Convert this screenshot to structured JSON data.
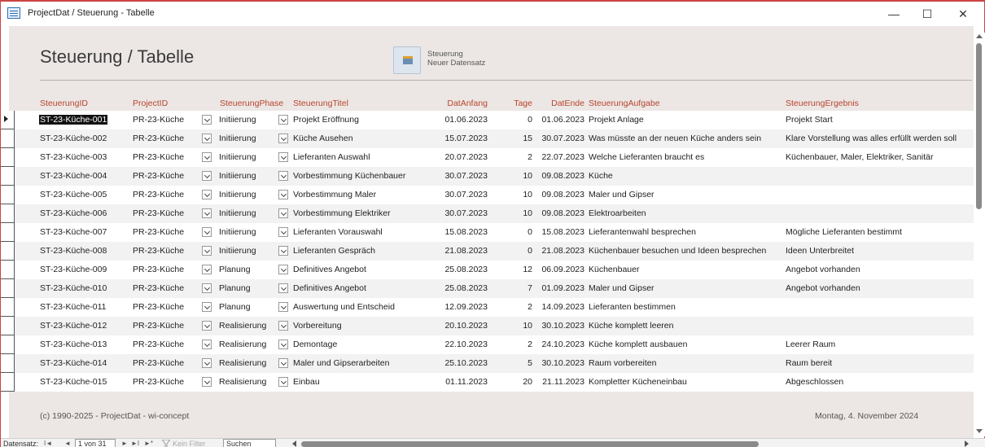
{
  "window": {
    "title": "ProjectDat / Steuerung - Tabelle",
    "minimize": "—",
    "maximize": "☐",
    "close": "✕"
  },
  "form": {
    "title": "Steuerung / Tabelle",
    "command": {
      "line1": "Steuerung",
      "line2": "Neuer Datensatz",
      "icon": "new-record-icon"
    }
  },
  "columns": {
    "id": "SteuerungID",
    "project": "ProjectID",
    "phase": "SteuerungPhase",
    "titel": "SteuerungTitel",
    "anfang": "DatAnfang",
    "tage": "Tage",
    "ende": "DatEnde",
    "aufgabe": "SteuerungAufgabe",
    "ergebnis": "SteuerungErgebnis"
  },
  "rows": [
    {
      "id": "ST-23-Küche-001",
      "project": "PR-23-Küche",
      "phase": "Initiierung",
      "titel": "Projekt Eröffnung",
      "anfang": "01.06.2023",
      "tage": "0",
      "ende": "01.06.2023",
      "aufgabe": "Projekt Anlage",
      "ergebnis": "Projekt Start"
    },
    {
      "id": "ST-23-Küche-002",
      "project": "PR-23-Küche",
      "phase": "Initiierung",
      "titel": "Küche Ausehen",
      "anfang": "15.07.2023",
      "tage": "15",
      "ende": "30.07.2023",
      "aufgabe": "Was müsste an der neuen Küche anders sein",
      "ergebnis": "Klare Vorstellung was alles erfüllt werden soll"
    },
    {
      "id": "ST-23-Küche-003",
      "project": "PR-23-Küche",
      "phase": "Initiierung",
      "titel": "Lieferanten Auswahl",
      "anfang": "20.07.2023",
      "tage": "2",
      "ende": "22.07.2023",
      "aufgabe": "Welche Lieferanten braucht es",
      "ergebnis": "Küchenbauer, Maler, Elektriker, Sanitär"
    },
    {
      "id": "ST-23-Küche-004",
      "project": "PR-23-Küche",
      "phase": "Initiierung",
      "titel": "Vorbestimmung Küchenbauer",
      "anfang": "30.07.2023",
      "tage": "10",
      "ende": "09.08.2023",
      "aufgabe": "Küche",
      "ergebnis": ""
    },
    {
      "id": "ST-23-Küche-005",
      "project": "PR-23-Küche",
      "phase": "Initiierung",
      "titel": "Vorbestimmung Maler",
      "anfang": "30.07.2023",
      "tage": "10",
      "ende": "09.08.2023",
      "aufgabe": "Maler und Gipser",
      "ergebnis": ""
    },
    {
      "id": "ST-23-Küche-006",
      "project": "PR-23-Küche",
      "phase": "Initiierung",
      "titel": "Vorbestimmung Elektriker",
      "anfang": "30.07.2023",
      "tage": "10",
      "ende": "09.08.2023",
      "aufgabe": "Elektroarbeiten",
      "ergebnis": ""
    },
    {
      "id": "ST-23-Küche-007",
      "project": "PR-23-Küche",
      "phase": "Initiierung",
      "titel": "Lieferanten Vorauswahl",
      "anfang": "15.08.2023",
      "tage": "0",
      "ende": "15.08.2023",
      "aufgabe": "Lieferantenwahl besprechen",
      "ergebnis": "Mögliche Lieferanten bestimmt"
    },
    {
      "id": "ST-23-Küche-008",
      "project": "PR-23-Küche",
      "phase": "Initiierung",
      "titel": "Lieferanten Gespräch",
      "anfang": "21.08.2023",
      "tage": "0",
      "ende": "21.08.2023",
      "aufgabe": "Küchenbauer besuchen und Ideen besprechen",
      "ergebnis": "Ideen Unterbreitet"
    },
    {
      "id": "ST-23-Küche-009",
      "project": "PR-23-Küche",
      "phase": "Planung",
      "titel": "Definitives Angebot",
      "anfang": "25.08.2023",
      "tage": "12",
      "ende": "06.09.2023",
      "aufgabe": "Küchenbauer",
      "ergebnis": "Angebot vorhanden"
    },
    {
      "id": "ST-23-Küche-010",
      "project": "PR-23-Küche",
      "phase": "Planung",
      "titel": "Definitives Angebot",
      "anfang": "25.08.2023",
      "tage": "7",
      "ende": "01.09.2023",
      "aufgabe": "Maler und Gipser",
      "ergebnis": "Angebot vorhanden"
    },
    {
      "id": "ST-23-Küche-011",
      "project": "PR-23-Küche",
      "phase": "Planung",
      "titel": "Auswertung und Entscheid",
      "anfang": "12.09.2023",
      "tage": "2",
      "ende": "14.09.2023",
      "aufgabe": "Lieferanten bestimmen",
      "ergebnis": ""
    },
    {
      "id": "ST-23-Küche-012",
      "project": "PR-23-Küche",
      "phase": "Realisierung",
      "titel": "Vorbereitung",
      "anfang": "20.10.2023",
      "tage": "10",
      "ende": "30.10.2023",
      "aufgabe": "Küche komplett leeren",
      "ergebnis": ""
    },
    {
      "id": "ST-23-Küche-013",
      "project": "PR-23-Küche",
      "phase": "Realisierung",
      "titel": "Demontage",
      "anfang": "22.10.2023",
      "tage": "2",
      "ende": "24.10.2023",
      "aufgabe": "Küche komplett ausbauen",
      "ergebnis": "Leerer Raum"
    },
    {
      "id": "ST-23-Küche-014",
      "project": "PR-23-Küche",
      "phase": "Realisierung",
      "titel": "Maler und Gipserarbeiten",
      "anfang": "25.10.2023",
      "tage": "5",
      "ende": "30.10.2023",
      "aufgabe": "Raum vorbereiten",
      "ergebnis": "Raum bereit"
    },
    {
      "id": "ST-23-Küche-015",
      "project": "PR-23-Küche",
      "phase": "Realisierung",
      "titel": "Einbau",
      "anfang": "01.11.2023",
      "tage": "20",
      "ende": "21.11.2023",
      "aufgabe": "Kompletter Kücheneinbau",
      "ergebnis": "Abgeschlossen"
    }
  ],
  "footer": {
    "copyright": "(c) 1990-2025 - ProjectDat - wi-concept",
    "date": "Montag, 4. November 2024"
  },
  "navbar": {
    "label": "Datensatz:",
    "first": "I◄",
    "prev": "◄",
    "record": "1 von 31",
    "next": "►",
    "last": "►I",
    "new": "►*",
    "filter": "Kein Filter",
    "search": "Suchen"
  },
  "colors": {
    "header_text": "#b8442b",
    "form_background": "#ece7e5",
    "window_border": "#cc4444"
  }
}
